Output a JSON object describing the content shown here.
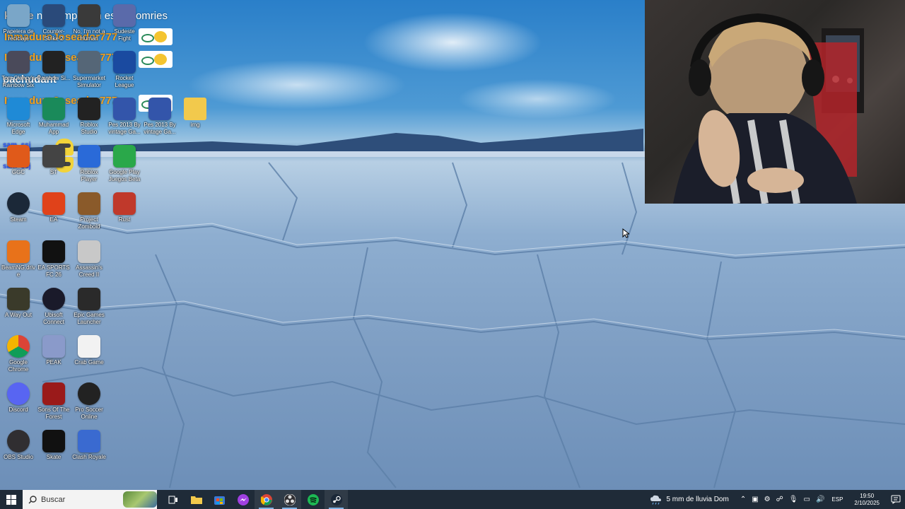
{
  "overlay": {
    "chat": [
      {
        "user": "klipze",
        "text": "no compro en esos nomries",
        "color": "#ffffff"
      },
      {
        "user": "InmaduroJoseador777",
        "color": "#f0a020"
      },
      {
        "user": "InmaduroJoseador777",
        "color": "#f0a020"
      },
      {
        "user": "pachudant",
        "color": "#ffffff"
      },
      {
        "user": "InmaduroJoseador777",
        "color": "#f0a020"
      },
      {
        "user": "sam_ssj",
        "color": "#2a55ff"
      },
      {
        "user": "sam_ssj",
        "color": "#2a55ff"
      }
    ],
    "ok_text": "ok"
  },
  "desktop_icons": [
    {
      "label": "Papelera de reciclaje",
      "icon": "recycle-bin-icon",
      "color": "#7aa6c8"
    },
    {
      "label": "Counter-Strike 2",
      "icon": "counter-strike-icon",
      "color": "#2a4a7a"
    },
    {
      "label": "No, I'm not a Human",
      "icon": "game-icon",
      "color": "#3a3a3a"
    },
    {
      "label": "Sudeste Fight",
      "icon": "game-icon",
      "color": "#5a6aaa"
    },
    {
      "label": "Tom Clancy's Rainbow Six",
      "icon": "rainbow-six-icon",
      "color": "#4a4a5a"
    },
    {
      "label": "Rainbow Si...",
      "icon": "game-icon",
      "color": "#222222"
    },
    {
      "label": "Supermarket Simulator",
      "icon": "game-icon",
      "color": "#556677"
    },
    {
      "label": "Rocket League",
      "icon": "rocket-league-icon",
      "color": "#1a4aa0"
    },
    {
      "label": "Microsoft Edge",
      "icon": "edge-icon",
      "color": "#1f8ad6"
    },
    {
      "label": "Muhammad App",
      "icon": "app-icon",
      "color": "#1a8a5a"
    },
    {
      "label": "Roblox Studio",
      "icon": "roblox-studio-icon",
      "color": "#222222"
    },
    {
      "label": "Pes 2013 By vintage Ga...",
      "icon": "pes-icon",
      "color": "#3355aa"
    },
    {
      "label": "Pes 2013 By vintage Ga...",
      "icon": "pes-icon",
      "color": "#3355aa"
    },
    {
      "label": "img",
      "icon": "folder-icon",
      "color": "#f2c94c"
    },
    {
      "label": "GGC",
      "icon": "ggc-icon",
      "color": "#e05a1a"
    },
    {
      "label": "ST",
      "icon": "app-icon",
      "color": "#444444"
    },
    {
      "label": "Roblox Player",
      "icon": "roblox-icon",
      "color": "#2a6ad8"
    },
    {
      "label": "Google Play Juegos Beta",
      "icon": "google-play-icon",
      "color": "#2aa84a"
    },
    {
      "label": "Steam",
      "icon": "steam-icon",
      "color": "#1b2838"
    },
    {
      "label": "EA",
      "icon": "ea-icon",
      "color": "#e0421a"
    },
    {
      "label": "Project Zomboid",
      "icon": "zomboid-icon",
      "color": "#8a5a2a"
    },
    {
      "label": "Rust",
      "icon": "rust-icon",
      "color": "#c0392b"
    },
    {
      "label": "BeamNG.drive",
      "icon": "beamng-icon",
      "color": "#e8721a"
    },
    {
      "label": "EA SPORTS FC 26",
      "icon": "fc26-icon",
      "color": "#111111"
    },
    {
      "label": "Assassin's Creed II",
      "icon": "assassins-creed-icon",
      "color": "#c8c8c8"
    },
    {
      "label": "A Way Out",
      "icon": "a-way-out-icon",
      "color": "#3a3a2a"
    },
    {
      "label": "Ubisoft Connect",
      "icon": "ubisoft-icon",
      "color": "#1a1a2a"
    },
    {
      "label": "Epic Games Launcher",
      "icon": "epic-games-icon",
      "color": "#2a2a2a"
    },
    {
      "label": "Google Chrome",
      "icon": "chrome-icon",
      "color": "#ffffff"
    },
    {
      "label": "PEAK",
      "icon": "peak-icon",
      "color": "#8a9aca"
    },
    {
      "label": "Crab Game",
      "icon": "crab-game-icon",
      "color": "#f2f2f2"
    },
    {
      "label": "Discord",
      "icon": "discord-icon",
      "color": "#5865f2"
    },
    {
      "label": "Sons Of The Forest",
      "icon": "sons-forest-icon",
      "color": "#9a1a1a"
    },
    {
      "label": "Pro Soccer Online",
      "icon": "soccer-icon",
      "color": "#222222"
    },
    {
      "label": "OBS Studio",
      "icon": "obs-icon",
      "color": "#302e31"
    },
    {
      "label": "Skate",
      "icon": "skate-icon",
      "color": "#111111"
    },
    {
      "label": "Clash Royale",
      "icon": "clash-royale-icon",
      "color": "#3a6ad0"
    }
  ],
  "taskbar": {
    "search_placeholder": "Buscar",
    "apps": [
      {
        "name": "task-view-icon"
      },
      {
        "name": "file-explorer-icon"
      },
      {
        "name": "microsoft-store-icon"
      },
      {
        "name": "messenger-icon"
      },
      {
        "name": "chrome-taskbar-icon"
      },
      {
        "name": "obs-taskbar-icon"
      },
      {
        "name": "spotify-icon"
      },
      {
        "name": "steam-taskbar-icon"
      }
    ],
    "weather": "5 mm de lluvia Dom",
    "language": "ESP",
    "time": "19:50",
    "date": "2/10/2025"
  }
}
